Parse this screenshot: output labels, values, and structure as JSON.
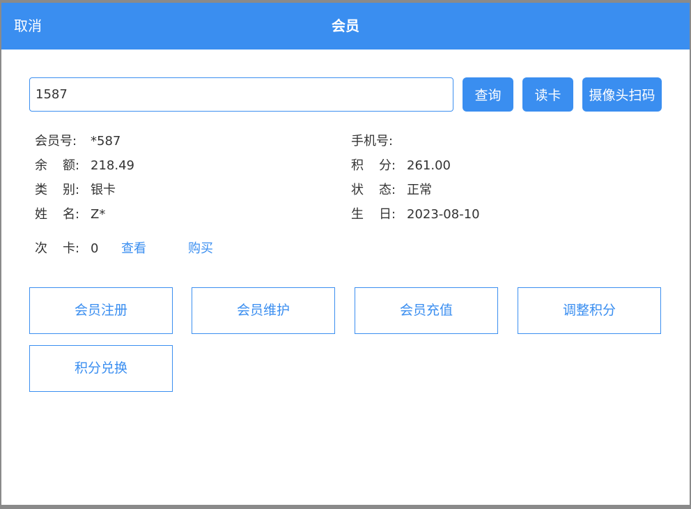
{
  "header": {
    "cancel_label": "取消",
    "title": "会员"
  },
  "search": {
    "value": "1587"
  },
  "buttons": {
    "query": "查询",
    "read_card": "读卡",
    "scan": "摄像头扫码"
  },
  "info": {
    "member_no_label": "会员号:",
    "member_no": "*587",
    "phone_label": "手机号:",
    "phone": "",
    "balance_label_1": "余",
    "balance_label_2": "额:",
    "balance": "218.49",
    "points_label_1": "积",
    "points_label_2": "分:",
    "points": "261.00",
    "category_label_1": "类",
    "category_label_2": "别:",
    "category": "银卡",
    "status_label_1": "状",
    "status_label_2": "态:",
    "status": "正常",
    "name_label_1": "姓",
    "name_label_2": "名:",
    "name": "Z*",
    "birthday_label_1": "生",
    "birthday_label_2": "日:",
    "birthday": "2023-08-10",
    "times_card_label_1": "次",
    "times_card_label_2": "卡:",
    "times_card": "0",
    "view_link": "查看",
    "buy_link": "购买"
  },
  "actions": {
    "register": "会员注册",
    "maintain": "会员维护",
    "recharge": "会员充值",
    "adjust_points": "调整积分",
    "redeem_points": "积分兑换"
  }
}
